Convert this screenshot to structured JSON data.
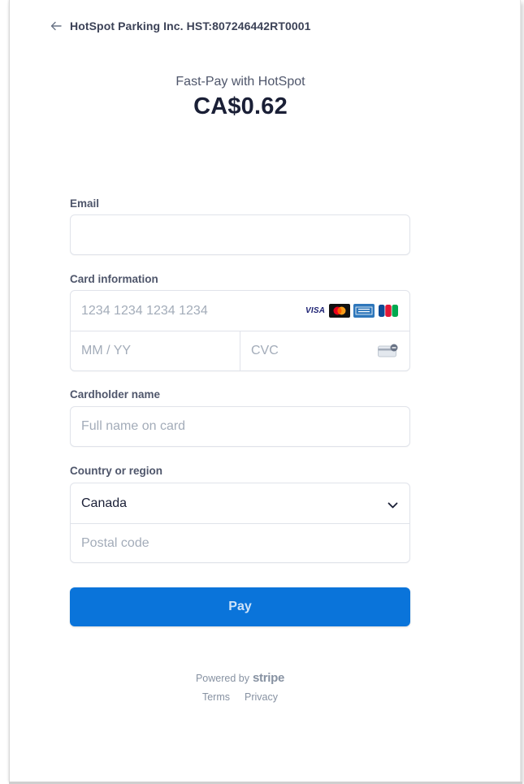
{
  "header": {
    "merchant_label": "HotSpot Parking Inc. HST:807246442RT0001"
  },
  "summary": {
    "product_name": "Fast-Pay with HotSpot",
    "amount": "CA$0.62"
  },
  "form": {
    "email": {
      "label": "Email",
      "value": "",
      "placeholder": ""
    },
    "card": {
      "label": "Card information",
      "number_placeholder": "1234 1234 1234 1234",
      "expiry_placeholder": "MM / YY",
      "cvc_placeholder": "CVC",
      "brands": [
        "visa-icon",
        "mastercard-icon",
        "amex-icon",
        "jcb-icon"
      ],
      "visa_text": "VISA"
    },
    "cardholder": {
      "label": "Cardholder name",
      "placeholder": "Full name on card"
    },
    "country": {
      "label": "Country or region",
      "selected": "Canada",
      "postal_placeholder": "Postal code"
    }
  },
  "pay_button": {
    "label": "Pay",
    "color": "#0a74da"
  },
  "footer": {
    "powered_by": "Powered by",
    "brand": "stripe",
    "terms": "Terms",
    "privacy": "Privacy"
  }
}
